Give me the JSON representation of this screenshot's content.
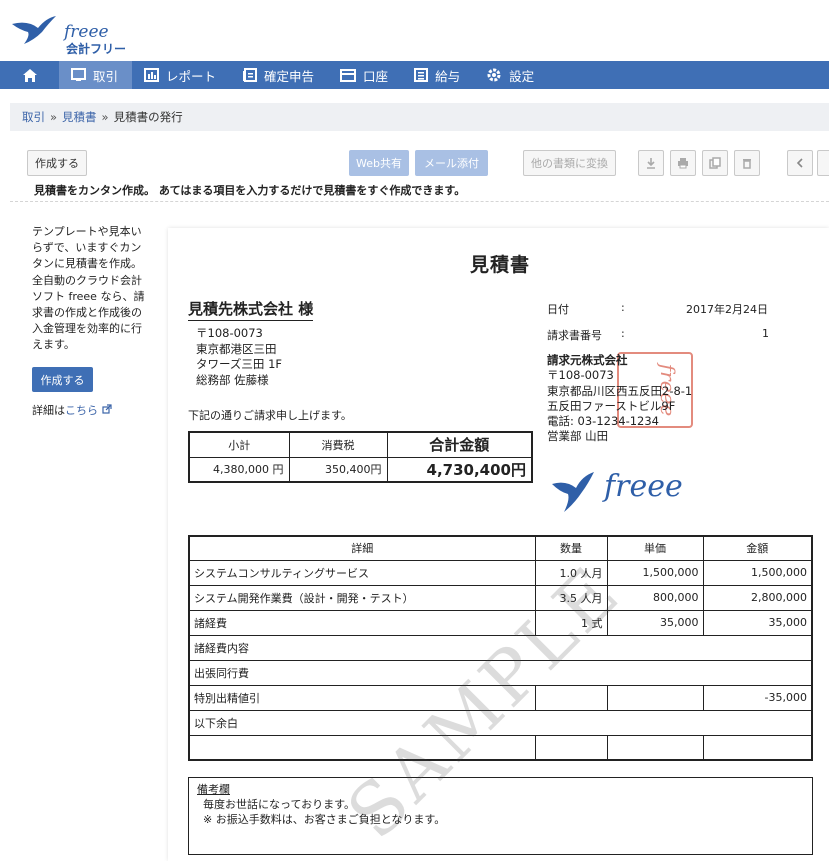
{
  "brand": {
    "name": "freee",
    "product": "会計フリー"
  },
  "nav": {
    "items": [
      {
        "label": "取引"
      },
      {
        "label": "レポート"
      },
      {
        "label": "確定申告"
      },
      {
        "label": "口座"
      },
      {
        "label": "給与"
      },
      {
        "label": "設定"
      }
    ]
  },
  "breadcrumb": {
    "root": "取引",
    "sep": "»",
    "parent": "見積書",
    "current": "見積書の発行"
  },
  "toolbar": {
    "create": "作成する",
    "web_share": "Web共有",
    "mail_send": "メール添付",
    "convert": "他の書類に変換",
    "headline": "見積書をカンタン作成。 あてはまる項目を入力するだけで見積書をすぐ作成できます。"
  },
  "side": {
    "text": "テンプレートや見本いらずで、いますぐカンタンに見積書を作成。全自動のクラウド会計ソフト freee なら、請求書の作成と作成後の入金管理を効率的に行えます。",
    "button": "作成する",
    "link_prefix": "詳細は",
    "link_text": "こちら"
  },
  "doc": {
    "title": "見積書",
    "client": "見積先株式会社 様",
    "client_addr": [
      "〒108-0073",
      "東京都港区三田",
      "タワーズ三田 1F",
      "総務部 佐藤様"
    ],
    "note": "下記の通りご請求申し上げます。",
    "date_label": "日付",
    "colon": ":",
    "date": "2017年2月24日",
    "number_label": "請求書番号",
    "number": "1",
    "issuer": [
      "請求元株式会社",
      "〒108-0073",
      "東京都品川区西五反田2-8-1",
      "五反田ファーストビル9F",
      "電話: 03-1234-1234",
      "営業部 山田"
    ],
    "stamp": "freee",
    "logo": "freee",
    "summary": {
      "headers": [
        "小計",
        "消費税",
        "合計金額"
      ],
      "values": [
        "4,380,000 円",
        "350,400円",
        "4,730,400円"
      ]
    },
    "items": {
      "headers": [
        "詳細",
        "数量",
        "単価",
        "金額"
      ],
      "rows": [
        [
          "システムコンサルティングサービス",
          "1.0 人月",
          "1,500,000",
          "1,500,000"
        ],
        [
          "システム開発作業費（設計・開発・テスト）",
          "3.5 人月",
          "800,000",
          "2,800,000"
        ],
        [
          "諸経費",
          "1 式",
          "35,000",
          "35,000"
        ],
        [
          "諸経費内容",
          "",
          "",
          ""
        ],
        [
          "出張同行費",
          "",
          "",
          ""
        ],
        [
          "特別出精値引",
          "",
          "",
          "-35,000"
        ],
        [
          "以下余白",
          "",
          "",
          ""
        ],
        [
          "",
          "",
          "",
          ""
        ]
      ]
    },
    "remarks": {
      "title": "備考欄",
      "lines": [
        "毎度お世話になっております。",
        "※ お振込手数料は、お客さまご負担となります。"
      ]
    },
    "watermark": "SAMPLE"
  }
}
